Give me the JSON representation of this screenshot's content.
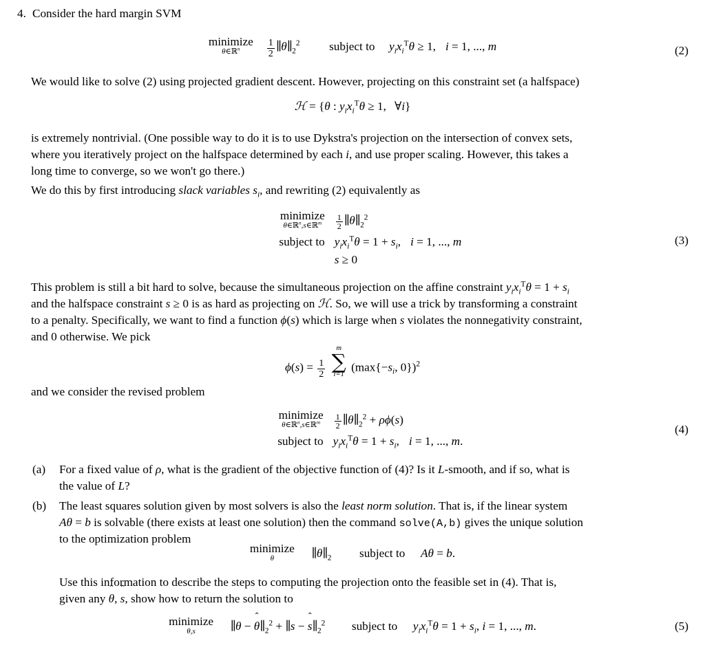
{
  "document": {
    "problem_number": "4.",
    "problem_title": "Consider the hard margin SVM",
    "equation_numbers": {
      "eq2": "(2)",
      "eq3": "(3)",
      "eq4": "(4)",
      "eq5": "(5)"
    },
    "labels": {
      "minimize": "minimize",
      "subject_to": "subject to"
    },
    "equations": {
      "eq2": {
        "objective": "1/2 ||θ||₂²",
        "variable_domain": "θ∈ℝⁿ",
        "constraint": "y_i x_i^T θ ≥ 1,  i = 1, ..., m"
      },
      "halfspace_set": "H = {θ : y_i x_i^T θ ≥ 1,  ∀i}",
      "eq3": {
        "objective": "½ ||θ||₂²",
        "variable_domain": "θ∈ℝⁿ, s∈ℝᵐ",
        "constraint1": "y_i x_i^T θ = 1 + s_i,  i = 1, ..., m",
        "constraint2": "s ≥ 0"
      },
      "phi": "φ(s) = 1/2 Σ_{i=1}^{m} (max{−s_i, 0})²",
      "eq4": {
        "objective": "½ ||θ||₂² + ρφ(s)",
        "variable_domain": "θ∈ℝⁿ, s∈ℝᵐ",
        "constraint": "y_i x_i^T θ = 1 + s_i,  i = 1, ..., m."
      },
      "least_norm": {
        "objective": "||θ||₂",
        "variable": "θ",
        "constraint": "Aθ = b."
      },
      "eq5": {
        "objective": "||θ − θ̂||₂² + ||s − ŝ||₂²",
        "variable": "θ,s",
        "constraint": "y_i x_i^T θ = 1 + s_i, i = 1, ..., m."
      }
    },
    "paragraphs": {
      "p1_a": "We would like to solve (2) using projected gradient descent. However, projecting on this constraint set (a halfspace)",
      "p2_a": "is extremely nontrivial. (One possible way to do it is to use Dykstra's projection on the intersection of convex sets,",
      "p2_b": "where you iteratively project on the halfspace determined by each ",
      "p2_b_math": "i",
      "p2_b_cont": ", and use proper scaling. However, this takes a",
      "p2_c": "long time to converge, so we won't go there.)",
      "p3_a": "We do this by first introducing ",
      "p3_italic": "slack variables",
      "p3_math": "s",
      "p3_sub": "i",
      "p3_b": ", and rewriting (2) equivalently as",
      "p4_a": "This problem is still a bit hard to solve, because the simultaneous projection on the affine constraint ",
      "p4_b": "and the halfspace constraint ",
      "p4_b2": " is as hard as projecting on ",
      "p4_b3": ". So, we will use a trick by transforming a constraint",
      "p4_c": "to a penalty. Specifically, we want to find a function ",
      "p4_c2": " which is large when ",
      "p4_c3": " violates the nonnegativity constraint,",
      "p4_d": "and 0 otherwise. We pick",
      "p5": "and we consider the revised problem",
      "p_use_a": "Use this information to describe the steps to computing the projection onto the feasible set in (4). That is,",
      "p_use_b": "given any ",
      "p_use_b2": ", show how to return the solution to"
    },
    "sub_items": {
      "a": {
        "marker": "(a)",
        "line1_pre": "For a fixed value of ",
        "line1_rho": "ρ",
        "line1_mid": ", what is the gradient of the objective function of (4)? Is it ",
        "line1_L": "L",
        "line1_post": "-smooth, and if so, what is",
        "line2_pre": "the value of ",
        "line2_L": "L",
        "line2_post": "?"
      },
      "b": {
        "marker": "(b)",
        "line1_pre": "The least squares solution given by most solvers is also the ",
        "line1_italic": "least norm solution",
        "line1_post": ". That is, if the linear system",
        "line2_pre": " is solvable (there exists at least one solution) then the command ",
        "line2_code": "solve(A,b)",
        "line2_post": " gives the unique solution",
        "line3": "to the optimization problem"
      }
    }
  }
}
